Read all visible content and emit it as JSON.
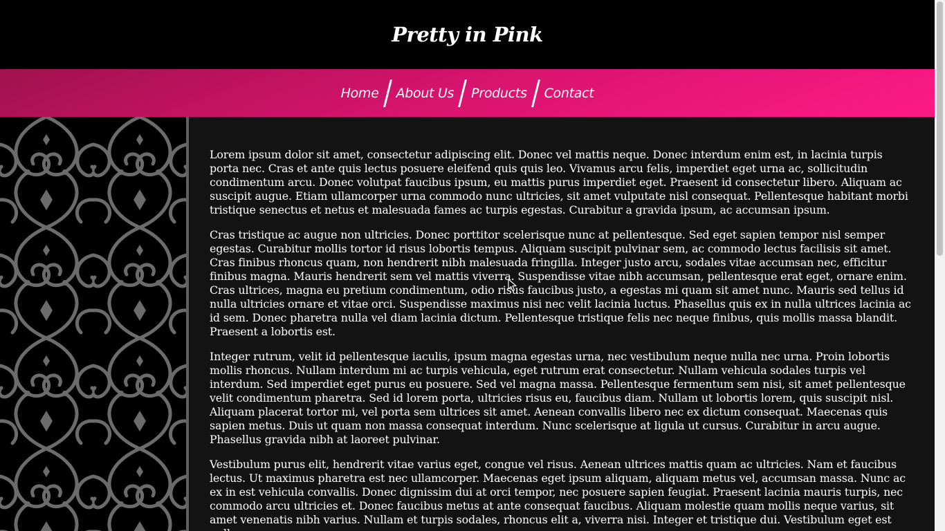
{
  "site": {
    "title": "Pretty in Pink"
  },
  "nav": {
    "items": [
      {
        "label": "Home"
      },
      {
        "label": "About Us"
      },
      {
        "label": "Products"
      },
      {
        "label": "Contact"
      }
    ]
  },
  "content": {
    "paragraphs": [
      "Lorem ipsum dolor sit amet, consectetur adipiscing elit. Donec vel mattis neque. Donec interdum enim est, in lacinia turpis porta nec. Cras et ante quis lectus posuere eleifend quis quis leo. Vivamus arcu felis, imperdiet eget urna ac, sollicitudin condimentum arcu. Donec volutpat faucibus ipsum, eu mattis purus imperdiet eget. Praesent id consectetur libero. Aliquam ac suscipit augue. Etiam ullamcorper urna commodo nunc ultricies, sit amet vulputate nisl consequat. Pellentesque habitant morbi tristique senectus et netus et malesuada fames ac turpis egestas. Curabitur a gravida ipsum, ac accumsan ipsum.",
      "Cras tristique ac augue non ultricies. Donec porttitor scelerisque nunc at pellentesque. Sed eget sapien tempor nisl semper egestas. Curabitur mollis tortor id risus lobortis tempus. Aliquam suscipit pulvinar sem, ac commodo lectus facilisis sit amet. Cras finibus rhoncus quam, non hendrerit nibh malesuada fringilla. Integer justo arcu, sodales vitae accumsan nec, efficitur finibus magna. Mauris hendrerit sem vel mattis viverra. Suspendisse vitae nibh accumsan, pellentesque erat eget, ornare enim. Cras ultrices, magna eu pretium condimentum, odio risus faucibus justo, a egestas mi quam sit amet nunc. Mauris sed tellus id nulla ultricies ornare et vitae orci. Suspendisse maximus nisi nec velit lacinia luctus. Phasellus quis ex in nulla ultrices lacinia ac id sem. Donec pharetra nulla vel diam lacinia dictum. Pellentesque tristique felis nec neque finibus, quis mollis massa blandit. Praesent a lobortis est.",
      "Integer rutrum, velit id pellentesque iaculis, ipsum magna egestas urna, nec vestibulum neque nulla nec urna. Proin lobortis mollis rhoncus. Nullam interdum mi ac turpis vehicula, eget rutrum erat consectetur. Nullam vehicula sodales turpis vel interdum. Sed imperdiet eget purus eu posuere. Sed vel magna massa. Pellentesque fermentum sem nisi, sit amet pellentesque velit condimentum pharetra. Sed id lorem porta, ultricies risus eu, faucibus diam. Nullam ut lobortis lorem, quis suscipit nisl. Aliquam placerat tortor mi, vel porta sem ultrices sit amet. Aenean convallis libero nec ex dictum consequat. Maecenas quis sapien metus. Duis ut quam non massa consequat interdum. Nunc scelerisque at ligula ut cursus. Curabitur in arcu augue. Phasellus gravida nibh at laoreet pulvinar.",
      "Vestibulum purus elit, hendrerit vitae varius eget, congue vel risus. Aenean ultrices mattis quam ac ultricies. Nam et faucibus lectus. Ut maximus pharetra est nec ullamcorper. Maecenas eget ipsum aliquam, aliquam metus vel, accumsan massa. Nunc ac ex in est vehicula convallis. Donec dignissim dui at orci tempor, nec posuere sapien feugiat. Praesent lacinia mauris turpis, nec commodo arcu ultricies et. Donec faucibus metus at ante consequat faucibus. Aliquam molestie quam mollis neque varius, sit amet venenatis nibh varius. Nullam et turpis sodales, rhoncus elit a, viverra nisi. Integer et tristique dui. Vestibulum eget est nulla."
    ]
  },
  "theme": {
    "header_bg": "#000000",
    "nav_gradient_start": "#a0124d",
    "nav_gradient_end": "#ff1a86",
    "content_bg": "#131313",
    "sidebar_pattern": "#6b6b6b",
    "sidebar_border": "#5f5f5f"
  },
  "decor": {
    "sidebar_pattern_icon": "ornamental-scroll-pattern",
    "cursor_icon": "arrow-cursor-icon"
  }
}
